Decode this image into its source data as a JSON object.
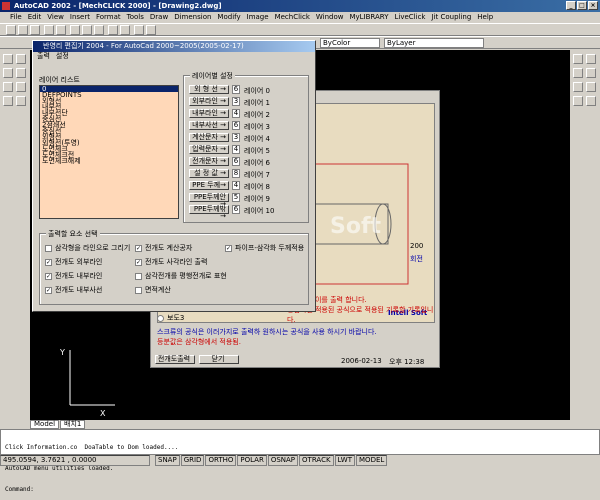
{
  "app": {
    "title": "AutoCAD 2002 - [MechCLICK 2000] - [Drawing2.dwg]"
  },
  "menu": [
    "File",
    "Edit",
    "View",
    "Insert",
    "Format",
    "Tools",
    "Draw",
    "Dimension",
    "Modify",
    "Image",
    "MechClick",
    "Window",
    "MyLIBRARY",
    "LiveClick",
    "Jit Coupling",
    "Help"
  ],
  "toolbar": {
    "layer_value": "ByColor",
    "linetype_value": "ByLayer"
  },
  "dialog": {
    "title": "반영리 편집기 2004 - For AutoCad 2000~2005(2005-02-17)",
    "tabs": [
      "출력",
      "설정"
    ],
    "layer_list": {
      "label": "레이어 리스트",
      "items": [
        "0",
        "DEFPOINTS",
        "외형선",
        "내부선",
        "내부선단",
        "중심선",
        "2점쇄선",
        "중심선",
        "외형선",
        "외형선(투영)",
        "도면체크",
        "도면체크전",
        "도면체크해제"
      ]
    },
    "layer_settings": {
      "label": "레이어별 설정",
      "rows": [
        {
          "name": "외 형 선 →",
          "num": "6",
          "layer": "레이어 0"
        },
        {
          "name": "외부라인 →",
          "num": "3",
          "layer": "레이어 1"
        },
        {
          "name": "내부라인 →",
          "num": "4",
          "layer": "레이어 2"
        },
        {
          "name": "내부사선 →",
          "num": "6",
          "layer": "레이어 3"
        },
        {
          "name": "계산문자 →",
          "num": "3",
          "layer": "레이어 4"
        },
        {
          "name": "입력문자 →",
          "num": "4",
          "layer": "레이어 5"
        },
        {
          "name": "전개문자 →",
          "num": "6",
          "layer": "레이어 6"
        },
        {
          "name": "설 정 값 →",
          "num": "8",
          "layer": "레이어 7"
        },
        {
          "name": "PPE 두께→",
          "num": "4",
          "layer": "레이어 8"
        },
        {
          "name": "PPE두께안→",
          "num": "5",
          "layer": "레이어 9"
        },
        {
          "name": "PPE두께밖→",
          "num": "6",
          "layer": "레이어 10"
        }
      ]
    },
    "options": {
      "label": "출력할 요소 선택",
      "items": [
        {
          "label": "삼각형을 라인으로 그리기",
          "checked": false
        },
        {
          "label": "전개도 계산공자",
          "checked": true
        },
        {
          "label": "파이프-삼각화 두께적용",
          "checked": true
        },
        {
          "label": "전개도 외부라인",
          "checked": true
        },
        {
          "label": "전개도 사각라인 출력",
          "checked": true
        },
        {
          "label": "전개도 내부라인",
          "checked": true
        },
        {
          "label": "삼각전개를 평행전개로 표현",
          "checked": false
        },
        {
          "label": "전개도 내부사선",
          "checked": true
        },
        {
          "label": "면적계산",
          "checked": false
        }
      ]
    }
  },
  "dialog2": {
    "note1": "스크류의 공식은 이러가지로 출력하 원하시는 공식을 사용 하시기 바랍니다.",
    "note2": "등분값은 삼각형에서 적용됨.",
    "note3": "원화 번호이를 출력 합니다.",
    "note4": "경험적인 적용된 공식으로 적용된 기록할 기록입니다.",
    "radio": "보도3",
    "dimension": "200",
    "dimension_label": "회전",
    "watermark": "Soft",
    "brand": "Intell Soft",
    "buttons": [
      "전개도출력",
      "닫기"
    ],
    "date": "2006-02-13",
    "time": "오후 12:38"
  },
  "layout_tabs": [
    "Model",
    "배치1"
  ],
  "command_lines": [
    "Click Information.co  DoaTable to Dom loaded....",
    "AutoCAD menu utilities loaded.",
    "Command:"
  ],
  "status": {
    "coords": "495.0594, 3.7621 , 0.0000",
    "toggles": [
      "SNAP",
      "GRID",
      "ORTHO",
      "POLAR",
      "OSNAP",
      "OTRACK",
      "LWT",
      "MODEL"
    ]
  }
}
